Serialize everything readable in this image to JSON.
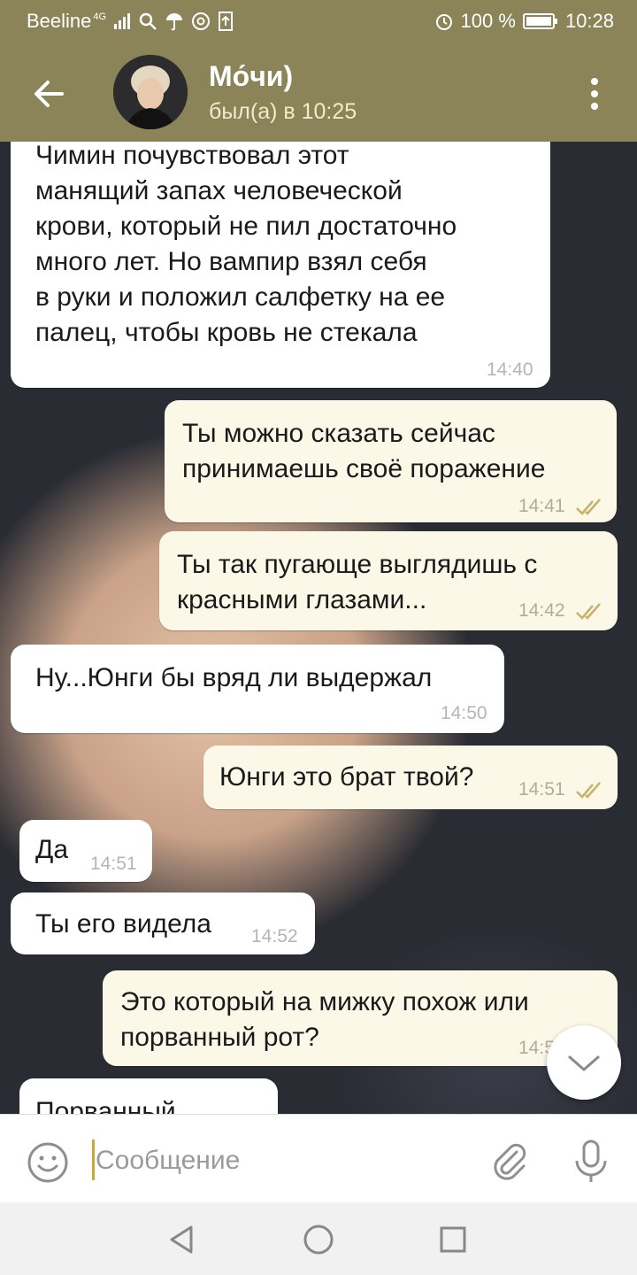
{
  "status_bar": {
    "carrier": "Beeline",
    "network": "4G",
    "battery": "100 %",
    "time": "10:28"
  },
  "header": {
    "title": "Мо́чи)",
    "subtitle": "был(а) в 10:25"
  },
  "messages": [
    {
      "dir": "in",
      "text": "Чимин почувствовал этот\nманящий запах человеческой\nкрови, который не пил достаточно\nмного лет. Но вампир взял себя\nв руки и положил салфетку на ее\nпалец, чтобы кровь не стекала",
      "time": "14:40"
    },
    {
      "dir": "out",
      "text": "Ты можно сказать сейчас\nпринимаешь своё поражение",
      "time": "14:41",
      "read": true
    },
    {
      "dir": "out",
      "text": "Ты так пугающе выглядишь с\nкрасными глазами...",
      "time": "14:42",
      "read": true
    },
    {
      "dir": "in",
      "text": "Ну...Юнги бы вряд ли выдержал",
      "time": "14:50"
    },
    {
      "dir": "out",
      "text": "Юнги это брат твой?",
      "time": "14:51",
      "read": true
    },
    {
      "dir": "in",
      "text": "Да",
      "time": "14:51"
    },
    {
      "dir": "in",
      "text": "Ты его видела",
      "time": "14:52"
    },
    {
      "dir": "out",
      "text": "Это который на мижку похож или\nпорванный рот?",
      "time": "14:5"
    },
    {
      "dir": "in",
      "text": "Порванный"
    }
  ],
  "composer": {
    "placeholder": "Сообщение"
  },
  "icons": {
    "back": "arrow-left-icon",
    "more": "more-vert-icon",
    "emoji": "emoji-icon",
    "attach": "paperclip-icon",
    "mic": "microphone-icon",
    "scroll": "chevron-down-icon",
    "read": "double-check-icon"
  },
  "colors": {
    "header": "#8a8458",
    "bubble_out": "#fbf8e8",
    "bubble_in": "#ffffff",
    "check": "#c6b26a"
  }
}
